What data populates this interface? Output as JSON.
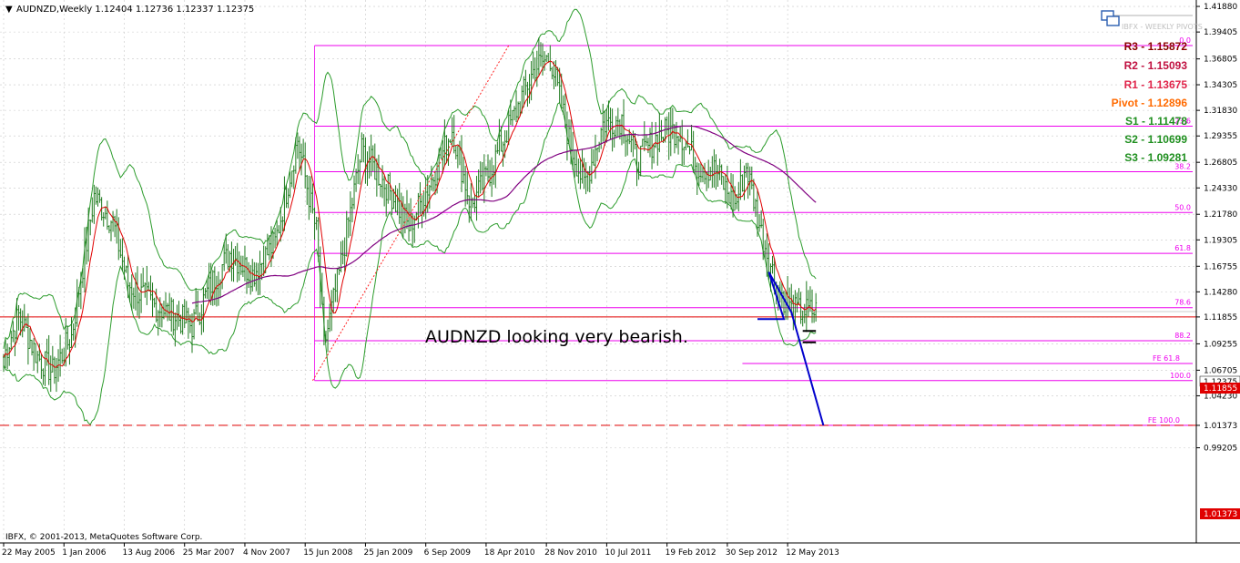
{
  "header": {
    "title_prefix": "▼",
    "title": "AUDNZD,Weekly  1.12404 1.12736 1.12337 1.12375"
  },
  "copyright": "IBFX, © 2001-2013, MetaQuotes Software Corp.",
  "annotation": "AUDNZD looking very bearish.",
  "pivot_panel": {
    "header": "IBFX - WEEKLY PIVOTS",
    "levels": [
      {
        "text": "R3 - 1.15872",
        "color": "#8b0000"
      },
      {
        "text": "R2 - 1.15093",
        "color": "#c01040"
      },
      {
        "text": "R1 - 1.13675",
        "color": "#e0244a"
      },
      {
        "text": "Pivot - 1.12896",
        "color": "#ff6a00"
      },
      {
        "text": "S1 - 1.11478",
        "color": "#1f8f1f"
      },
      {
        "text": "S2 - 1.10699",
        "color": "#1f8f1f"
      },
      {
        "text": "S3 - 1.09281",
        "color": "#1f8f1f"
      }
    ]
  },
  "colors": {
    "price_bars": "#1e7a1e",
    "bollinger": "#2c9c2c",
    "fast_ma": "#e00000",
    "slow_ma": "#800080",
    "fib": "#ee00ee",
    "current_price": "#e00000",
    "projection": "#0000cc",
    "trend_dotted": "#ff2020"
  },
  "chart_data": {
    "type": "candlestick",
    "symbol": "AUDNZD",
    "timeframe": "Weekly",
    "ohlc": {
      "open": 1.12404,
      "high": 1.12736,
      "low": 1.12337,
      "close": 1.12375
    },
    "ylim": [
      0.9,
      1.425
    ],
    "y_ticks": [
      "1.41880",
      "1.39405",
      "1.36805",
      "1.34305",
      "1.31830",
      "1.29355",
      "1.26805",
      "1.24330",
      "1.21780",
      "1.19305",
      "1.16755",
      "1.14280",
      "1.11855",
      "1.09255",
      "1.06705",
      "1.04230",
      "1.01373",
      "0.99205"
    ],
    "x_ticks": [
      "22 May 2005",
      "1 Jan 2006",
      "13 Aug 2006",
      "25 Mar 2007",
      "4 Nov 2007",
      "15 Jun 2008",
      "25 Jan 2009",
      "6 Sep 2009",
      "18 Apr 2010",
      "28 Nov 2010",
      "10 Jul 2011",
      "19 Feb 2012",
      "30 Sep 2012",
      "12 May 2013"
    ],
    "x_tick_indices": [
      0,
      32,
      64,
      96,
      128,
      160,
      192,
      224,
      256,
      288,
      320,
      352,
      384,
      416
    ],
    "n_bars": 432,
    "current_price_label": "1.12375",
    "horizontal_line": {
      "value": 1.11855,
      "label": "1.11855"
    },
    "fe100_label": "1.01373",
    "fe100_value": 1.01373,
    "fibonacci": {
      "start_index": 165,
      "end_index": 600,
      "levels": [
        {
          "label": "0.0",
          "value": 1.381
        },
        {
          "label": "23.6",
          "value": 1.303
        },
        {
          "label": "38.2",
          "value": 1.259
        },
        {
          "label": "50.0",
          "value": 1.2195
        },
        {
          "label": "61.8",
          "value": 1.18
        },
        {
          "label": "78.6",
          "value": 1.1275
        },
        {
          "label": "88.2",
          "value": 1.0955
        },
        {
          "label": "100.0",
          "value": 1.057
        }
      ]
    },
    "fib_expansion": {
      "start_index": 392,
      "levels": [
        {
          "label": "FE 61.8",
          "value": 1.0735
        },
        {
          "label": "FE 100.0",
          "value": 1.0137
        }
      ]
    },
    "fib_trend_line": {
      "from": {
        "index": 164,
        "value": 1.057
      },
      "to": {
        "index": 268,
        "value": 1.381
      }
    },
    "projection": {
      "points": [
        {
          "index": 400,
          "value": 1.1165
        },
        {
          "index": 414,
          "value": 1.1165
        },
        {
          "index": 406,
          "value": 1.162
        },
        {
          "index": 418,
          "value": 1.123
        },
        {
          "index": 435,
          "value": 1.0137
        }
      ]
    },
    "key_prices": [
      {
        "index": 0,
        "value": 1.08
      },
      {
        "index": 8,
        "value": 1.12
      },
      {
        "index": 18,
        "value": 1.08
      },
      {
        "index": 26,
        "value": 1.065
      },
      {
        "index": 36,
        "value": 1.1
      },
      {
        "index": 48,
        "value": 1.235
      },
      {
        "index": 58,
        "value": 1.21
      },
      {
        "index": 66,
        "value": 1.15
      },
      {
        "index": 80,
        "value": 1.13
      },
      {
        "index": 100,
        "value": 1.11
      },
      {
        "index": 110,
        "value": 1.15
      },
      {
        "index": 120,
        "value": 1.18
      },
      {
        "index": 132,
        "value": 1.16
      },
      {
        "index": 144,
        "value": 1.19
      },
      {
        "index": 156,
        "value": 1.29
      },
      {
        "index": 166,
        "value": 1.2
      },
      {
        "index": 170,
        "value": 1.09
      },
      {
        "index": 178,
        "value": 1.16
      },
      {
        "index": 190,
        "value": 1.28
      },
      {
        "index": 205,
        "value": 1.24
      },
      {
        "index": 215,
        "value": 1.205
      },
      {
        "index": 228,
        "value": 1.255
      },
      {
        "index": 238,
        "value": 1.3
      },
      {
        "index": 248,
        "value": 1.225
      },
      {
        "index": 258,
        "value": 1.26
      },
      {
        "index": 270,
        "value": 1.31
      },
      {
        "index": 282,
        "value": 1.36
      },
      {
        "index": 290,
        "value": 1.37
      },
      {
        "index": 300,
        "value": 1.29
      },
      {
        "index": 308,
        "value": 1.245
      },
      {
        "index": 318,
        "value": 1.305
      },
      {
        "index": 328,
        "value": 1.31
      },
      {
        "index": 336,
        "value": 1.27
      },
      {
        "index": 348,
        "value": 1.295
      },
      {
        "index": 358,
        "value": 1.3
      },
      {
        "index": 368,
        "value": 1.265
      },
      {
        "index": 378,
        "value": 1.26
      },
      {
        "index": 388,
        "value": 1.225
      },
      {
        "index": 394,
        "value": 1.265
      },
      {
        "index": 402,
        "value": 1.2
      },
      {
        "index": 410,
        "value": 1.15
      },
      {
        "index": 418,
        "value": 1.124
      }
    ],
    "grid": true
  }
}
